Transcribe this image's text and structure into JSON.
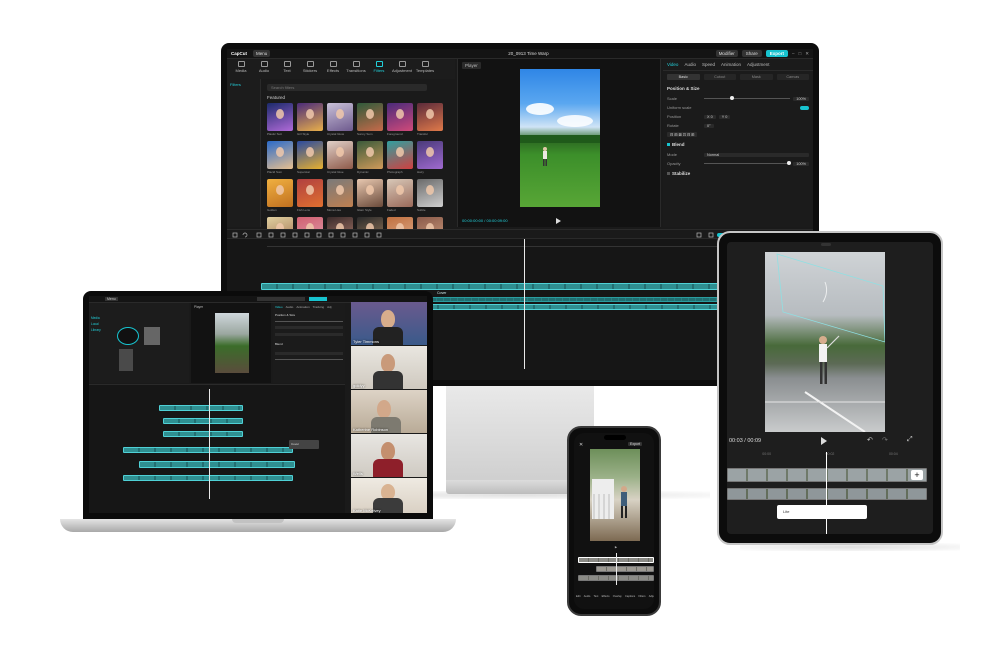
{
  "desktop": {
    "app_name": "CapCut",
    "menu_label": "Menu",
    "project_title": "20_0913 Time Warp",
    "top_right": {
      "label_a": "Modifier",
      "share": "Share",
      "export": "Export"
    },
    "tools": [
      "Media",
      "Audio",
      "Text",
      "Stickers",
      "Effects",
      "Transitions",
      "Filters",
      "Adjustment",
      "Templates"
    ],
    "active_tool_index": 6,
    "side_item": "Filters",
    "search_placeholder": "Search filters",
    "featured_label": "Featured",
    "filter_captions": [
      "Plastic Suit",
      "Girl Style",
      "Crystal Glow",
      "Sunny Sum",
      "Foreground",
      "Transfer",
      "Placid Sum",
      "Superstar",
      "Crystal Glue",
      "Dynamic",
      "Photograph",
      "Hazy",
      "Golden",
      "Fish Lens",
      "Mona Lisa",
      "Glam Style",
      "Faded",
      "Subtle"
    ],
    "player_label": "Player",
    "player_time": "00:00:00:00 / 00:00:09:00",
    "props": {
      "tabs": [
        "Video",
        "Audio",
        "Speed",
        "Animation",
        "Adjustment"
      ],
      "active_tab_index": 0,
      "subtabs": [
        "Basic",
        "Cutout",
        "Mask",
        "Canvas"
      ],
      "active_subtab_index": 0,
      "position_size": "Position & Size",
      "scale_label": "Scale",
      "scale_value": "100%",
      "uniform_label": "Uniform scale",
      "position_label": "Position",
      "pos_x": "X 0",
      "pos_y": "Y 0",
      "rotate_label": "Rotate",
      "rotate_value": "0°",
      "blend_label": "Blend",
      "mode_label": "Mode",
      "mode_value": "Normal",
      "opacity_label": "Opacity",
      "opacity_value": "100%",
      "stabilize_label": "Stabilize"
    },
    "timeline_clip_label": "Cover"
  },
  "laptop": {
    "menu_label": "Menu",
    "side_items": [
      "Media",
      "Local",
      "Library"
    ],
    "player_label": "Player",
    "props_tabs": [
      "Video",
      "Audio",
      "Animation",
      "Tracking",
      "Adj"
    ],
    "section": "Position & Size",
    "blend_label": "Blend",
    "callout": "Cover",
    "participants": [
      "Tyler Timmons",
      "goldyy",
      "Katherine Robinson",
      "Wells",
      "Katie McKelvey"
    ]
  },
  "phone": {
    "export_label": "Export",
    "close_icon": "close-icon",
    "bottom_tools": [
      "Edit",
      "Audio",
      "Text",
      "Effects",
      "Overlay",
      "Captions",
      "Filters",
      "Adjust"
    ]
  },
  "tablet": {
    "time": "00:03 / 00:09",
    "ruler_marks": [
      "00:00",
      "00:02",
      "00:04"
    ],
    "clip_label": "Lite"
  },
  "colors": {
    "accent": "#17c3cf",
    "panel": "#1a1a1a",
    "track": "#2f8f91"
  }
}
